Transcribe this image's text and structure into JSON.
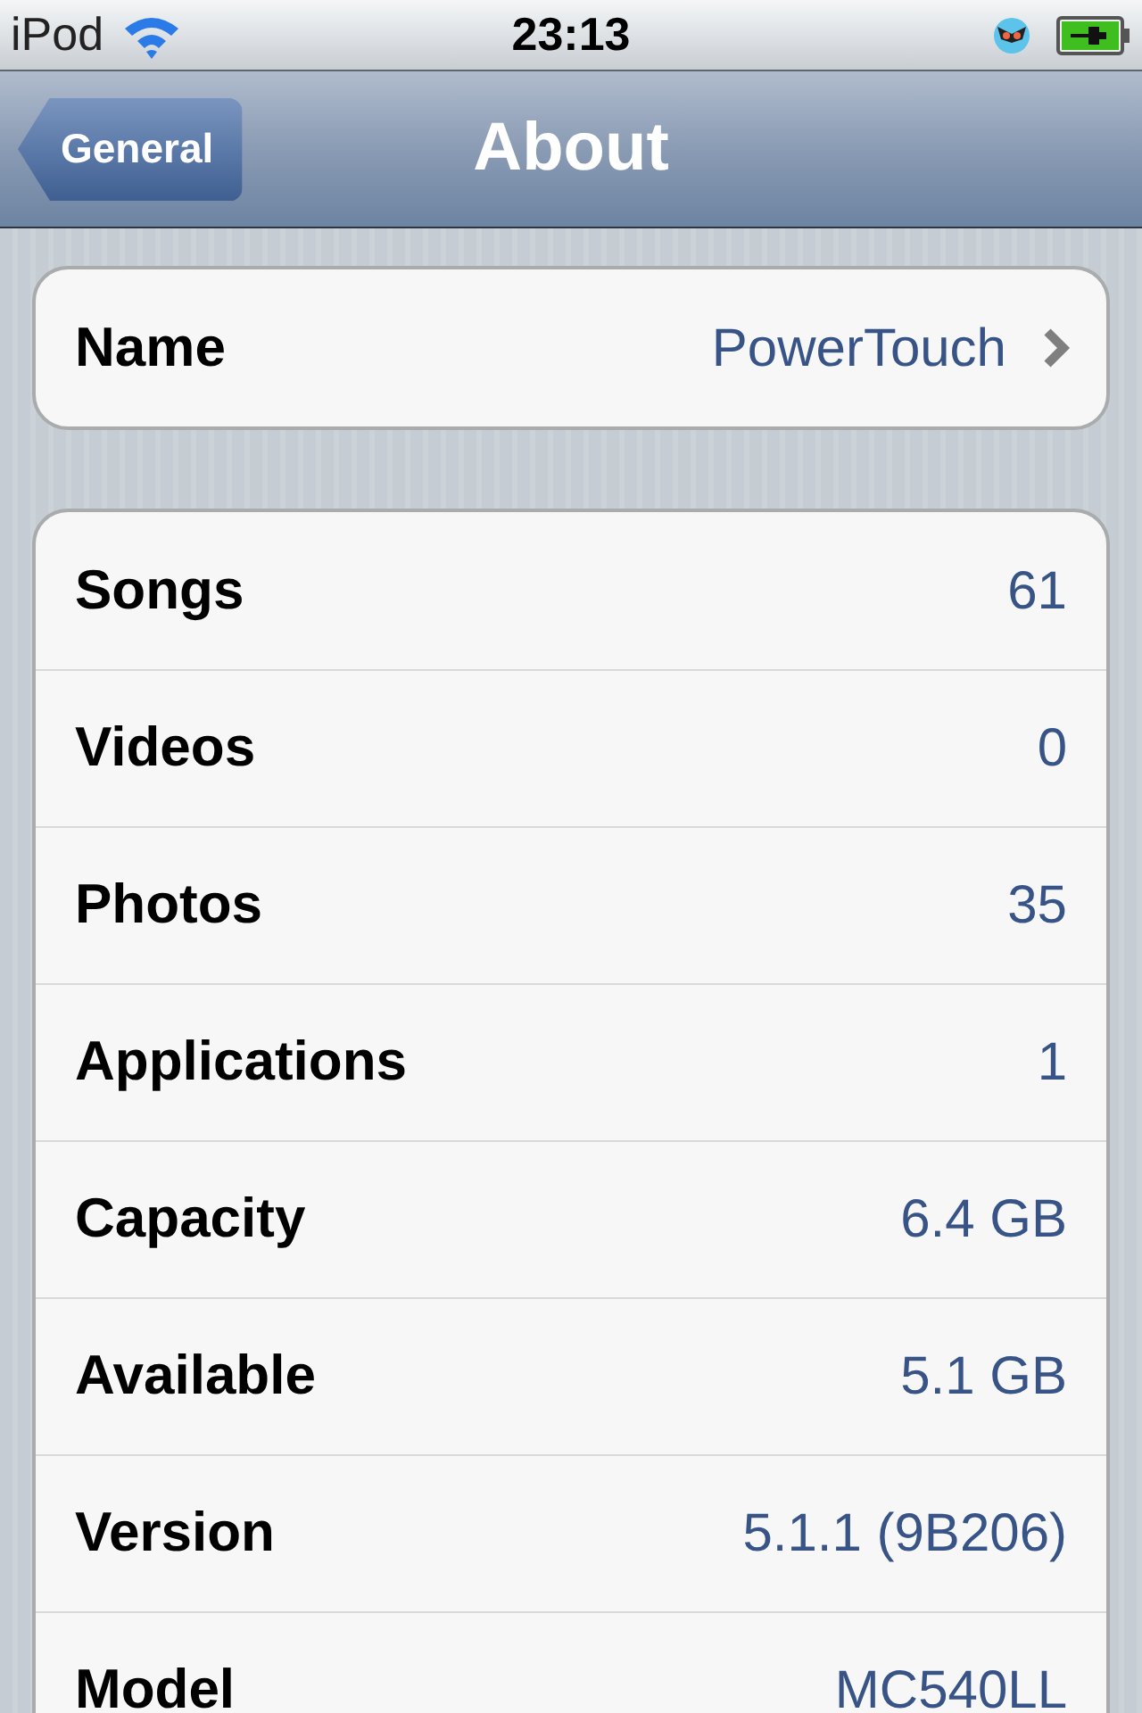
{
  "status_bar": {
    "carrier": "iPod",
    "time": "23:13"
  },
  "nav_bar": {
    "back": "General",
    "title": "About"
  },
  "groups": [
    {
      "rows": [
        {
          "kind": "disclosure",
          "label": "Name",
          "value": "PowerTouch"
        }
      ]
    },
    {
      "rows": [
        {
          "kind": "value",
          "label": "Songs",
          "value": "61"
        },
        {
          "kind": "value",
          "label": "Videos",
          "value": "0"
        },
        {
          "kind": "value",
          "label": "Photos",
          "value": "35"
        },
        {
          "kind": "value",
          "label": "Applications",
          "value": "1"
        },
        {
          "kind": "value",
          "label": "Capacity",
          "value": "6.4 GB"
        },
        {
          "kind": "value",
          "label": "Available",
          "value": "5.1 GB"
        },
        {
          "kind": "value",
          "label": "Version",
          "value": "5.1.1 (9B206)"
        },
        {
          "kind": "value",
          "label": "Model",
          "value": "MC540LL"
        }
      ]
    }
  ]
}
